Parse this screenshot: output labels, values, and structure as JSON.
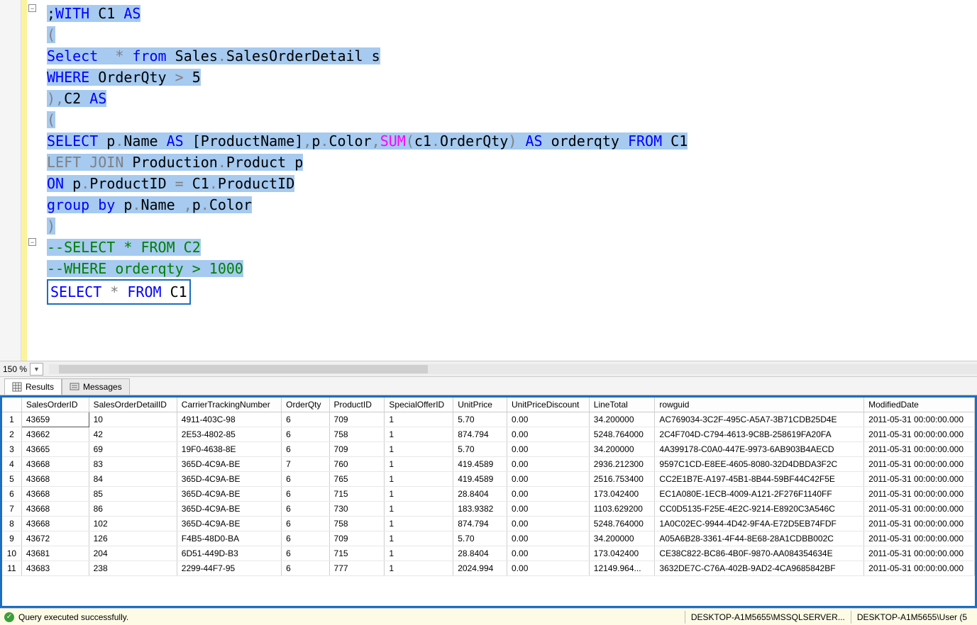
{
  "zoom": "150 %",
  "code": {
    "lines": [
      {
        "tokens": [
          {
            "t": ";",
            "c": "sel"
          },
          {
            "t": "WITH",
            "c": "kw sel"
          },
          {
            "t": " ",
            "c": "sel"
          },
          {
            "t": "C1 ",
            "c": "sel"
          },
          {
            "t": "AS",
            "c": "kw sel"
          }
        ]
      },
      {
        "tokens": [
          {
            "t": "(",
            "c": "gray sel"
          }
        ]
      },
      {
        "tokens": [
          {
            "t": "Select",
            "c": "kw sel"
          },
          {
            "t": "  ",
            "c": "sel"
          },
          {
            "t": "*",
            "c": "gray sel"
          },
          {
            "t": " ",
            "c": "sel"
          },
          {
            "t": "from",
            "c": "kw sel"
          },
          {
            "t": " Sales",
            "c": "sel"
          },
          {
            "t": ".",
            "c": "gray sel"
          },
          {
            "t": "SalesOrderDetail s",
            "c": "sel"
          }
        ]
      },
      {
        "tokens": [
          {
            "t": "WHERE",
            "c": "kw sel"
          },
          {
            "t": " OrderQty ",
            "c": "sel"
          },
          {
            "t": ">",
            "c": "gray sel"
          },
          {
            "t": " 5",
            "c": "sel"
          }
        ]
      },
      {
        "tokens": [
          {
            "t": ")",
            "c": "gray sel"
          },
          {
            "t": ",",
            "c": "gray sel"
          },
          {
            "t": "C2 ",
            "c": "sel"
          },
          {
            "t": "AS",
            "c": "kw sel"
          }
        ]
      },
      {
        "tokens": [
          {
            "t": "(",
            "c": "gray sel"
          }
        ]
      },
      {
        "tokens": [
          {
            "t": "SELECT",
            "c": "kw sel"
          },
          {
            "t": " p",
            "c": "sel"
          },
          {
            "t": ".",
            "c": "gray sel"
          },
          {
            "t": "Name ",
            "c": "sel"
          },
          {
            "t": "AS",
            "c": "kw sel"
          },
          {
            "t": " ",
            "c": "sel"
          },
          {
            "t": "[ProductName]",
            "c": "sel"
          },
          {
            "t": ",",
            "c": "gray sel"
          },
          {
            "t": "p",
            "c": "sel"
          },
          {
            "t": ".",
            "c": "gray sel"
          },
          {
            "t": "Color",
            "c": "sel"
          },
          {
            "t": ",",
            "c": "gray sel"
          },
          {
            "t": "SUM",
            "c": "func sel"
          },
          {
            "t": "(",
            "c": "gray sel"
          },
          {
            "t": "c1",
            "c": "sel"
          },
          {
            "t": ".",
            "c": "gray sel"
          },
          {
            "t": "OrderQty",
            "c": "sel"
          },
          {
            "t": ")",
            "c": "gray sel"
          },
          {
            "t": " ",
            "c": "sel"
          },
          {
            "t": "AS",
            "c": "kw sel"
          },
          {
            "t": " orderqty ",
            "c": "sel"
          },
          {
            "t": "FROM",
            "c": "kw sel"
          },
          {
            "t": " C1",
            "c": "sel"
          }
        ]
      },
      {
        "tokens": [
          {
            "t": "LEFT JOIN",
            "c": "gray sel"
          },
          {
            "t": " Production",
            "c": "sel"
          },
          {
            "t": ".",
            "c": "gray sel"
          },
          {
            "t": "Product p",
            "c": "sel"
          }
        ]
      },
      {
        "tokens": [
          {
            "t": "ON",
            "c": "kw sel"
          },
          {
            "t": " p",
            "c": "sel"
          },
          {
            "t": ".",
            "c": "gray sel"
          },
          {
            "t": "ProductID ",
            "c": "sel"
          },
          {
            "t": "=",
            "c": "gray sel"
          },
          {
            "t": " C1",
            "c": "sel"
          },
          {
            "t": ".",
            "c": "gray sel"
          },
          {
            "t": "ProductID",
            "c": "sel"
          }
        ]
      },
      {
        "tokens": [
          {
            "t": "group by",
            "c": "kw sel"
          },
          {
            "t": " p",
            "c": "sel"
          },
          {
            "t": ".",
            "c": "gray sel"
          },
          {
            "t": "Name ",
            "c": "sel"
          },
          {
            "t": ",",
            "c": "gray sel"
          },
          {
            "t": "p",
            "c": "sel"
          },
          {
            "t": ".",
            "c": "gray sel"
          },
          {
            "t": "Color",
            "c": "sel"
          }
        ]
      },
      {
        "tokens": [
          {
            "t": ")",
            "c": "gray sel"
          }
        ]
      },
      {
        "tokens": [
          {
            "t": "--SELECT * FROM C2",
            "c": "cm sel"
          }
        ]
      },
      {
        "tokens": [
          {
            "t": "--WHERE orderqty > 1000",
            "c": "cm sel"
          }
        ]
      },
      {
        "tokens": [
          {
            "t": "SELECT",
            "c": "kw"
          },
          {
            "t": " ",
            "c": ""
          },
          {
            "t": "*",
            "c": "gray"
          },
          {
            "t": " ",
            "c": ""
          },
          {
            "t": "FROM",
            "c": "kw"
          },
          {
            "t": " C1",
            "c": ""
          }
        ],
        "boxed": true
      }
    ]
  },
  "tabs": {
    "results": "Results",
    "messages": "Messages"
  },
  "columns": [
    "SalesOrderID",
    "SalesOrderDetailID",
    "CarrierTrackingNumber",
    "OrderQty",
    "ProductID",
    "SpecialOfferID",
    "UnitPrice",
    "UnitPriceDiscount",
    "LineTotal",
    "rowguid",
    "ModifiedDate"
  ],
  "rows": [
    [
      "43659",
      "10",
      "4911-403C-98",
      "6",
      "709",
      "1",
      "5.70",
      "0.00",
      "34.200000",
      "AC769034-3C2F-495C-A5A7-3B71CDB25D4E",
      "2011-05-31 00:00:00.000"
    ],
    [
      "43662",
      "42",
      "2E53-4802-85",
      "6",
      "758",
      "1",
      "874.794",
      "0.00",
      "5248.764000",
      "2C4F704D-C794-4613-9C8B-258619FA20FA",
      "2011-05-31 00:00:00.000"
    ],
    [
      "43665",
      "69",
      "19F0-4638-8E",
      "6",
      "709",
      "1",
      "5.70",
      "0.00",
      "34.200000",
      "4A399178-C0A0-447E-9973-6AB903B4AECD",
      "2011-05-31 00:00:00.000"
    ],
    [
      "43668",
      "83",
      "365D-4C9A-BE",
      "7",
      "760",
      "1",
      "419.4589",
      "0.00",
      "2936.212300",
      "9597C1CD-E8EE-4605-8080-32D4DBDA3F2C",
      "2011-05-31 00:00:00.000"
    ],
    [
      "43668",
      "84",
      "365D-4C9A-BE",
      "6",
      "765",
      "1",
      "419.4589",
      "0.00",
      "2516.753400",
      "CC2E1B7E-A197-45B1-8B44-59BF44C42F5E",
      "2011-05-31 00:00:00.000"
    ],
    [
      "43668",
      "85",
      "365D-4C9A-BE",
      "6",
      "715",
      "1",
      "28.8404",
      "0.00",
      "173.042400",
      "EC1A080E-1ECB-4009-A121-2F276F1140FF",
      "2011-05-31 00:00:00.000"
    ],
    [
      "43668",
      "86",
      "365D-4C9A-BE",
      "6",
      "730",
      "1",
      "183.9382",
      "0.00",
      "1103.629200",
      "CC0D5135-F25E-4E2C-9214-E8920C3A546C",
      "2011-05-31 00:00:00.000"
    ],
    [
      "43668",
      "102",
      "365D-4C9A-BE",
      "6",
      "758",
      "1",
      "874.794",
      "0.00",
      "5248.764000",
      "1A0C02EC-9944-4D42-9F4A-E72D5EB74FDF",
      "2011-05-31 00:00:00.000"
    ],
    [
      "43672",
      "126",
      "F4B5-48D0-BA",
      "6",
      "709",
      "1",
      "5.70",
      "0.00",
      "34.200000",
      "A05A6B28-3361-4F44-8E68-28A1CDBB002C",
      "2011-05-31 00:00:00.000"
    ],
    [
      "43681",
      "204",
      "6D51-449D-B3",
      "6",
      "715",
      "1",
      "28.8404",
      "0.00",
      "173.042400",
      "CE38C822-BC86-4B0F-9870-AA084354634E",
      "2011-05-31 00:00:00.000"
    ],
    [
      "43683",
      "238",
      "2299-44F7-95",
      "6",
      "777",
      "1",
      "2024.994",
      "0.00",
      "12149.964...",
      "3632DE7C-C76A-402B-9AD2-4CA9685842BF",
      "2011-05-31 00:00:00.000"
    ]
  ],
  "status": {
    "message": "Query executed successfully.",
    "server": "DESKTOP-A1M5655\\MSSQLSERVER...",
    "user": "DESKTOP-A1M5655\\User (5"
  }
}
